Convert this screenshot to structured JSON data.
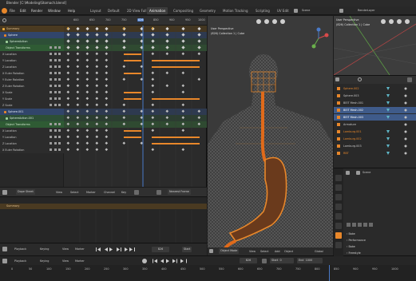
{
  "titlebar": {
    "title": "Blender [C:\\Modeling\\Stomach.blend]"
  },
  "menu": {
    "items": [
      "File",
      "Edit",
      "Render",
      "Window",
      "Help"
    ]
  },
  "workspaces": [
    "Layout",
    "Default",
    "2D View Full",
    "Animation",
    "Compositing",
    "Geometry",
    "Motion Tracking",
    "Scripting",
    "UV Edit"
  ],
  "active_workspace": "Animation",
  "scene": {
    "label": "Scene",
    "layer": "RenderLayer"
  },
  "dopesheet": {
    "ruler": [
      "600",
      "650",
      "700",
      "750",
      "800",
      "850",
      "900",
      "950",
      "1000"
    ],
    "current_frame": "826",
    "rows": [
      {
        "label": "Summary",
        "kind": "summary"
      },
      {
        "label": "Sphere",
        "kind": "object"
      },
      {
        "label": "SphereAction",
        "kind": "action"
      },
      {
        "label": "Object Transforms",
        "kind": "group"
      },
      {
        "label": "X Location",
        "kind": "channel"
      },
      {
        "label": "Y Location",
        "kind": "channel"
      },
      {
        "label": "Z Location",
        "kind": "channel"
      },
      {
        "label": "X Euler Rotation",
        "kind": "channel"
      },
      {
        "label": "Y Euler Rotation",
        "kind": "channel"
      },
      {
        "label": "Z Euler Rotation",
        "kind": "channel"
      },
      {
        "label": "X Scale",
        "kind": "channel"
      },
      {
        "label": "Y Scale",
        "kind": "channel"
      },
      {
        "label": "Z Scale",
        "kind": "channel"
      },
      {
        "label": "Sphere.001",
        "kind": "object"
      },
      {
        "label": "SphereAction.001",
        "kind": "action"
      },
      {
        "label": "Object Transforms",
        "kind": "group"
      },
      {
        "label": "X Location",
        "kind": "channel"
      },
      {
        "label": "Y Location",
        "kind": "channel"
      },
      {
        "label": "Z Location",
        "kind": "channel"
      },
      {
        "label": "X Euler Rotation",
        "kind": "channel"
      }
    ],
    "footer": {
      "mode": "Dope Sheet",
      "view": "View",
      "select": "Select",
      "marker": "Marker",
      "channel": "Channel",
      "key": "Key",
      "snap": "Nearest Frame"
    }
  },
  "graph": {
    "summary_label": "Summary"
  },
  "timeline": {
    "playback": "Playback",
    "keying": "Keying",
    "view": "View",
    "marker": "Marker",
    "frame": "826",
    "start_label": "Start",
    "start": "0",
    "end_label": "End",
    "end": "1000",
    "ruler": [
      "0",
      "50",
      "100",
      "150",
      "200",
      "250",
      "300",
      "350",
      "400",
      "450",
      "500",
      "550",
      "600",
      "650",
      "700",
      "750",
      "800",
      "850",
      "900",
      "950",
      "1000"
    ]
  },
  "viewport": {
    "view_label": "User Perspective",
    "collection_label": "(826) Collection 1 | Cube",
    "footer": {
      "mode": "Object Mode",
      "view": "View",
      "select": "Select",
      "add": "Add",
      "object": "Object",
      "global": "Global"
    }
  },
  "miniview": {
    "view_label": "User Perspective",
    "collection_label": "(826) Collection 1 | Cube"
  },
  "outliner": {
    "items": [
      {
        "label": "Sphere.002",
        "selected": false
      },
      {
        "label": "Sphere.003",
        "selected": false
      },
      {
        "label": "BEIT Mesh.001",
        "selected": false
      },
      {
        "label": "BEIT Mesh.002",
        "selected": true
      },
      {
        "label": "BEIT Mesh.003",
        "selected": true
      },
      {
        "label": "Armature",
        "selected": false
      },
      {
        "label": "Lamburg.001",
        "selected": false
      },
      {
        "label": "Lamburg.002",
        "selected": false
      },
      {
        "label": "Lamburg.003",
        "selected": false
      },
      {
        "label": "RBT",
        "selected": false
      }
    ]
  },
  "properties": {
    "scene_label": "Scene",
    "panels": [
      "Bake",
      "Performance",
      "Bake",
      "Freestyle"
    ]
  },
  "colors": {
    "accent": "#e8872a",
    "selection": "#3f5b8a",
    "keyframe": "#d7d7d7",
    "summary_key": "#e6a83a"
  }
}
